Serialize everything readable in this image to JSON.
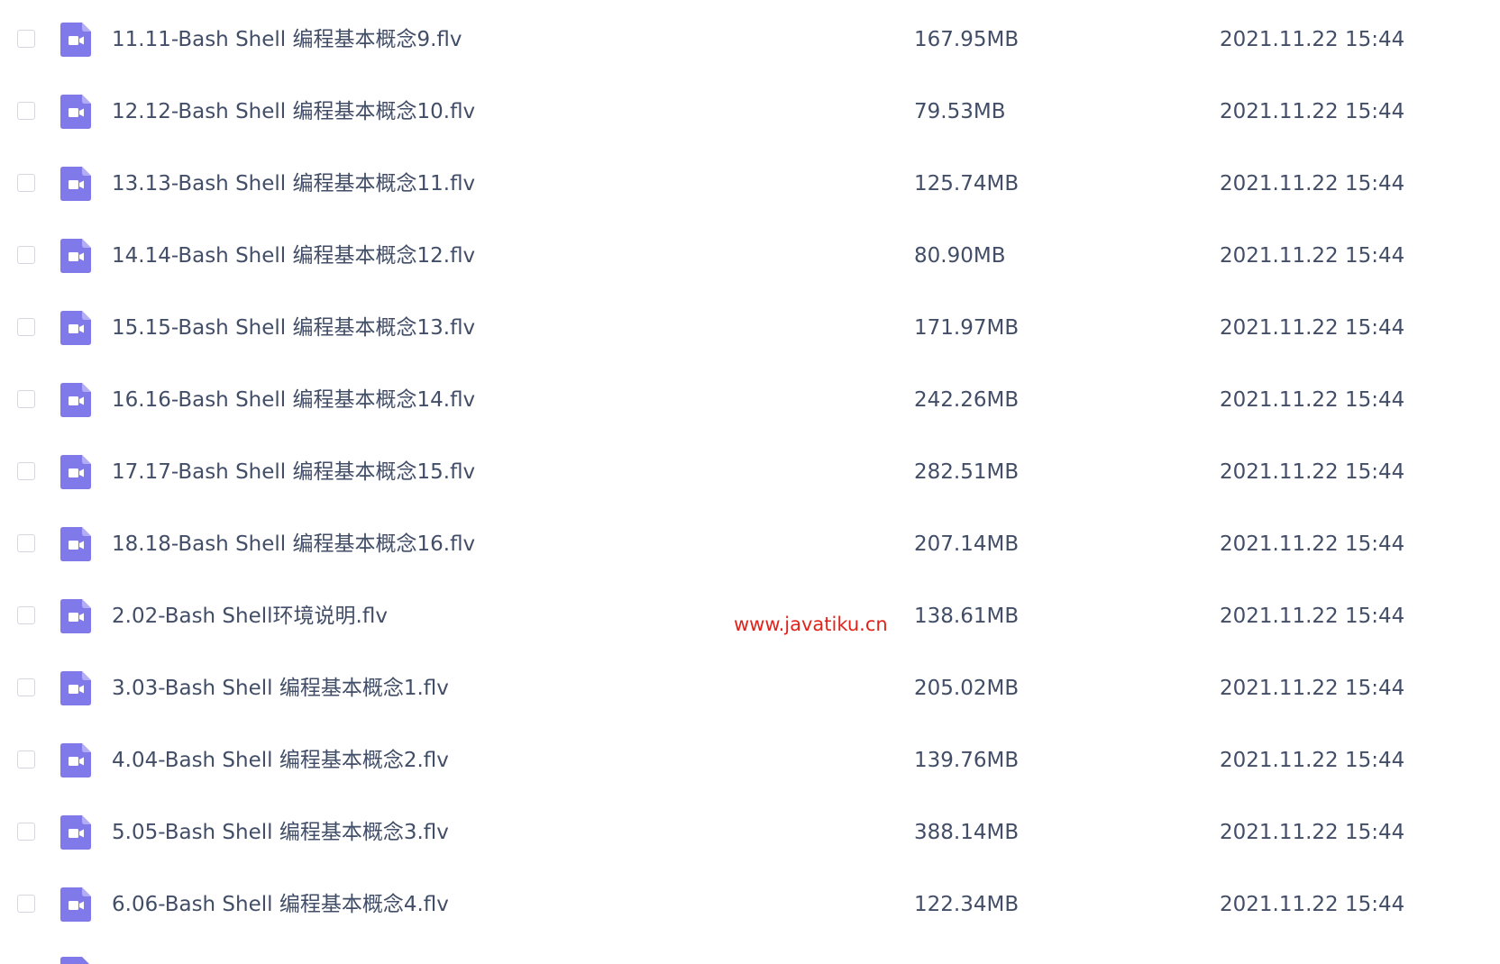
{
  "icons": {
    "file_type": "video-file-icon",
    "checkbox": "checkbox-unchecked"
  },
  "colors": {
    "icon_accent": "#8079e9",
    "text": "#424e67",
    "watermark": "#e0241b",
    "checkbox_border": "#d4d7de"
  },
  "files": [
    {
      "name": "11.11-Bash Shell 编程基本概念9.flv",
      "size": "167.95MB",
      "modified": "2021.11.22 15:44"
    },
    {
      "name": "12.12-Bash Shell 编程基本概念10.flv",
      "size": "79.53MB",
      "modified": "2021.11.22 15:44"
    },
    {
      "name": "13.13-Bash Shell 编程基本概念11.flv",
      "size": "125.74MB",
      "modified": "2021.11.22 15:44"
    },
    {
      "name": "14.14-Bash Shell 编程基本概念12.flv",
      "size": "80.90MB",
      "modified": "2021.11.22 15:44"
    },
    {
      "name": "15.15-Bash Shell 编程基本概念13.flv",
      "size": "171.97MB",
      "modified": "2021.11.22 15:44"
    },
    {
      "name": "16.16-Bash Shell 编程基本概念14.flv",
      "size": "242.26MB",
      "modified": "2021.11.22 15:44"
    },
    {
      "name": "17.17-Bash Shell 编程基本概念15.flv",
      "size": "282.51MB",
      "modified": "2021.11.22 15:44"
    },
    {
      "name": "18.18-Bash Shell 编程基本概念16.flv",
      "size": "207.14MB",
      "modified": "2021.11.22 15:44"
    },
    {
      "name": "2.02-Bash Shell环境说明.flv",
      "size": "138.61MB",
      "modified": "2021.11.22 15:44"
    },
    {
      "name": "3.03-Bash Shell 编程基本概念1.flv",
      "size": "205.02MB",
      "modified": "2021.11.22 15:44"
    },
    {
      "name": "4.04-Bash Shell 编程基本概念2.flv",
      "size": "139.76MB",
      "modified": "2021.11.22 15:44"
    },
    {
      "name": "5.05-Bash Shell 编程基本概念3.flv",
      "size": "388.14MB",
      "modified": "2021.11.22 15:44"
    },
    {
      "name": "6.06-Bash Shell 编程基本概念4.flv",
      "size": "122.34MB",
      "modified": "2021.11.22 15:44"
    }
  ],
  "watermark": "www.javatiku.cn"
}
